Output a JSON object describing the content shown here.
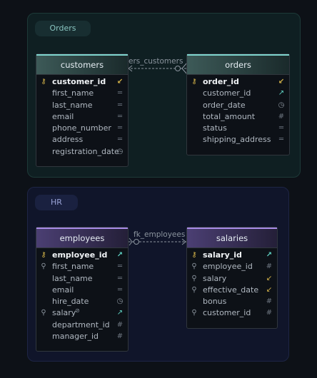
{
  "groups": {
    "orders": {
      "label": "Orders"
    },
    "hr": {
      "label": "HR"
    }
  },
  "tables": {
    "customers": {
      "title": "customers",
      "columns": [
        {
          "name": "customer_id",
          "pk": true,
          "icon": "key-icon",
          "type": "fk-arrow"
        },
        {
          "name": "first_name",
          "type": "text"
        },
        {
          "name": "last_name",
          "type": "text"
        },
        {
          "name": "email",
          "type": "text"
        },
        {
          "name": "phone_number",
          "type": "text"
        },
        {
          "name": "address",
          "type": "text"
        },
        {
          "name": "registration_date",
          "type": "time"
        }
      ]
    },
    "orders": {
      "title": "orders",
      "columns": [
        {
          "name": "order_id",
          "pk": true,
          "icon": "key-icon",
          "type": "fk-arrow"
        },
        {
          "name": "customer_id",
          "type": "ref-arrow"
        },
        {
          "name": "order_date",
          "type": "time"
        },
        {
          "name": "total_amount",
          "type": "number"
        },
        {
          "name": "status",
          "type": "text"
        },
        {
          "name": "shipping_address",
          "type": "text"
        }
      ]
    },
    "employees": {
      "title": "employees",
      "columns": [
        {
          "name": "employee_id",
          "pk": true,
          "icon": "key-icon",
          "type": "ref-arrow"
        },
        {
          "name": "first_name",
          "icon": "search-icon",
          "type": "text"
        },
        {
          "name": "last_name",
          "type": "text"
        },
        {
          "name": "email",
          "type": "text"
        },
        {
          "name": "hire_date",
          "type": "time"
        },
        {
          "name": "salary",
          "icon": "search-icon",
          "type": "ref-arrow",
          "extra": "⊘"
        },
        {
          "name": "department_id",
          "type": "number"
        },
        {
          "name": "manager_id",
          "type": "number"
        }
      ]
    },
    "salaries": {
      "title": "salaries",
      "columns": [
        {
          "name": "salary_id",
          "pk": true,
          "icon": "key-icon",
          "type": "ref-arrow"
        },
        {
          "name": "employee_id",
          "icon": "search-icon",
          "type": "number"
        },
        {
          "name": "salary",
          "icon": "search-icon",
          "type": "fk-arrow"
        },
        {
          "name": "effective_date",
          "icon": "search-icon",
          "type": "fk-arrow"
        },
        {
          "name": "bonus",
          "type": "number"
        },
        {
          "name": "customer_id",
          "icon": "search-icon",
          "type": "number"
        }
      ]
    }
  },
  "relationships": [
    {
      "label": "ers_customers"
    },
    {
      "label": "fk_employees"
    }
  ],
  "colors": {
    "orders_accent": "#7fd6cf",
    "hr_accent": "#a78be6",
    "key": "#d8b64a"
  }
}
